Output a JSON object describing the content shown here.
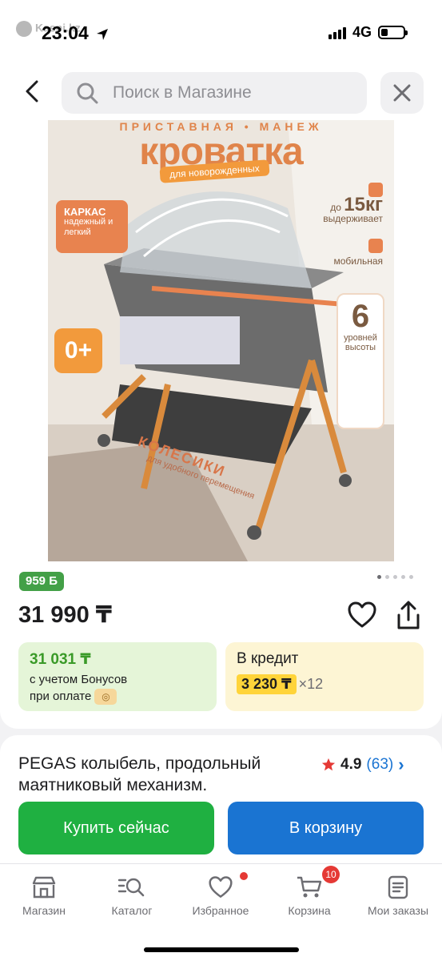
{
  "status": {
    "overlay_app": "Kaspi.kz",
    "time": "23:04",
    "network": "4G"
  },
  "search": {
    "placeholder": "Поиск в Магазине"
  },
  "product_image": {
    "subtitle": "ПРИСТАВНАЯ • МАНЕЖ",
    "title": "кроватка",
    "tag": "для новорожденных",
    "frame_badge_title": "КАРКАС",
    "frame_badge_text": "надежный и легкий",
    "age_badge": "0+",
    "weight_prefix": "до",
    "weight_value": "15кг",
    "weight_text": "выдерживает",
    "mobile_text": "мобильная",
    "levels_value": "6",
    "levels_text": "уровней высоты",
    "wheels_title": "КОЛЕСИКИ",
    "wheels_text": "для удобного перемещения"
  },
  "carousel": {
    "total": 5,
    "active": 0
  },
  "bonus_badge": "959 Б",
  "price": "31 990 ₸",
  "bonus_offer": {
    "price": "31 031 ₸",
    "line1": "с учетом Бонусов",
    "line2": "при оплате"
  },
  "credit_offer": {
    "title": "В кредит",
    "amount": "3 230 ₸",
    "multiplier": "×12"
  },
  "product": {
    "title": "PEGAS колыбель, продольный маятниковый механизм.",
    "rating": "4.9",
    "reviews": "(63)"
  },
  "actions": {
    "buy_now": "Купить сейчас",
    "add_to_cart": "В корзину"
  },
  "tabbar": {
    "items": [
      {
        "label": "Магазин",
        "icon": "store-icon"
      },
      {
        "label": "Каталог",
        "icon": "catalog-icon"
      },
      {
        "label": "Избранное",
        "icon": "heart-icon"
      },
      {
        "label": "Корзина",
        "icon": "cart-icon",
        "badge": "10"
      },
      {
        "label": "Мои заказы",
        "icon": "orders-icon"
      }
    ]
  },
  "colors": {
    "green": "#1fb041",
    "blue": "#1a74d2",
    "bonus_green": "#43a047",
    "credit_yellow": "#ffd43a",
    "badge_red": "#e53935"
  }
}
